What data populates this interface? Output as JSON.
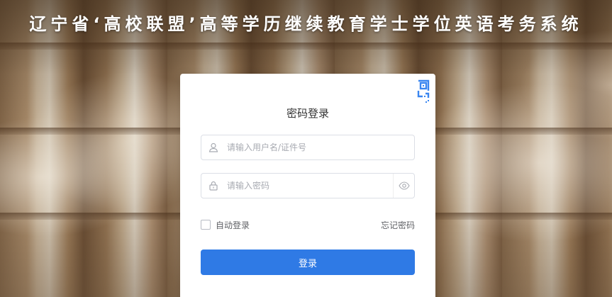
{
  "site": {
    "title": "辽宁省‘高校联盟’高等学历继续教育学士学位英语考务系统"
  },
  "login_card": {
    "title": "密码登录",
    "qr_icon": "qr-code-icon",
    "username": {
      "icon": "user-icon",
      "placeholder": "请输入用户名/证件号",
      "value": ""
    },
    "password": {
      "icon": "lock-icon",
      "placeholder": "请输入密码",
      "value": "",
      "toggle_icon": "eye-icon"
    },
    "remember_label": "自动登录",
    "remember_checked": false,
    "forgot_label": "忘记密码",
    "submit_label": "登录"
  },
  "colors": {
    "primary": "#2f7ae5",
    "qr_accent": "#3a86f0",
    "card_bg": "#ffffff",
    "text": "#333333",
    "placeholder": "#a8abb2"
  }
}
